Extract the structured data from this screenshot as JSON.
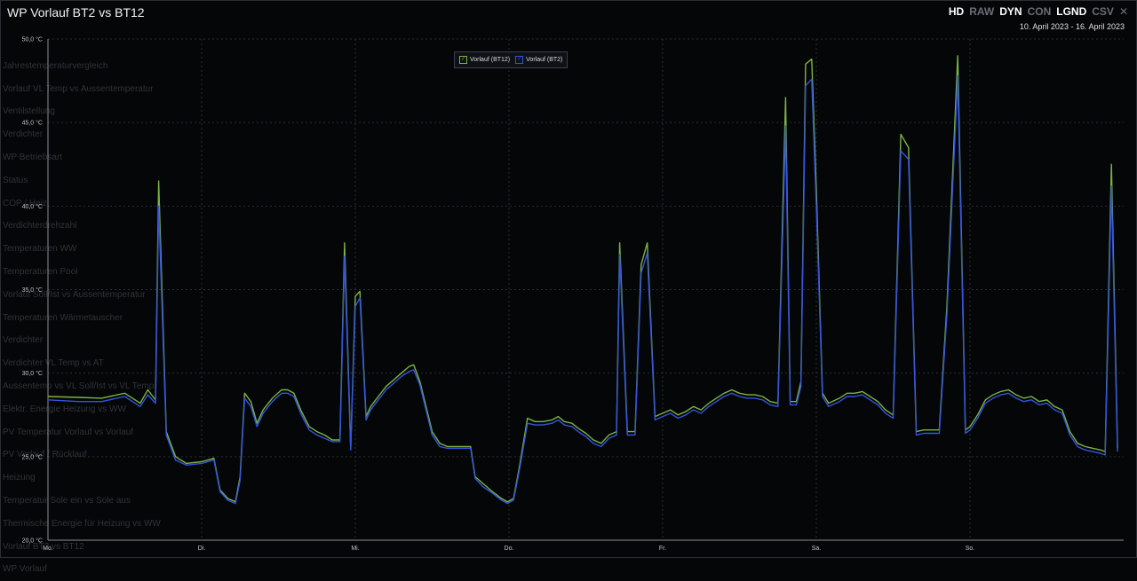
{
  "title": "WP Vorlauf BT2 vs BT12",
  "toolbar": [
    {
      "label": "HD",
      "active": true
    },
    {
      "label": "RAW",
      "active": false
    },
    {
      "label": "DYN",
      "active": true
    },
    {
      "label": "CON",
      "active": false
    },
    {
      "label": "LGND",
      "active": true
    },
    {
      "label": "CSV",
      "active": false
    }
  ],
  "close_symbol": "✕",
  "date_range": "10. April 2023 - 16. April 2023",
  "background_menu": [
    "",
    "Jahrestemperaturvergleich",
    "Vorlauf VL Temp vs Aussentemperatur",
    "Ventilstellung",
    "Verdichter",
    "WP Betriebsart",
    "Status",
    "COP / Heiz",
    "Verdichterdrehzahl",
    "Temperaturen WW",
    "Temperaturen Pool",
    "Vorlauf Soll/Ist vs Aussentemperatur",
    "Temperaturen Wärmetauscher",
    "Verdichter",
    "Verdichter VL Temp vs AT",
    "Aussentemp vs VL Soll/Ist vs VL Temp",
    "Elektr. Energie Heizung vs WW",
    "PV Temperatur Vorlauf vs Vorlauf",
    "PV Vorlauf / Rücklauf",
    "Heizung",
    "Temperatur Sole ein vs Sole aus",
    "Thermische Energie für Heizung vs WW",
    "Vorlauf BT2 vs BT12",
    "WP Vorlauf"
  ],
  "chart_data": {
    "type": "line",
    "title": "WP Vorlauf BT2 vs BT12",
    "y_unit": "°C",
    "ylim": [
      20,
      50
    ],
    "y_ticks": [
      "20,0 °C",
      "25,0 °C",
      "30,0 °C",
      "35,0 °C",
      "40,0 °C",
      "45,0 °C",
      "50,0 °C"
    ],
    "x_labels": [
      "Mo.",
      "Di.",
      "Mi.",
      "Do.",
      "Fr.",
      "Sa.",
      "So."
    ],
    "x_range_days": [
      0,
      7
    ],
    "grid": true,
    "legend_position": "top-center",
    "series": [
      {
        "name": "Vorlauf (BT12)",
        "color": "#7cb342",
        "points": [
          [
            0.0,
            28.6
          ],
          [
            0.2,
            28.55
          ],
          [
            0.35,
            28.5
          ],
          [
            0.5,
            28.8
          ],
          [
            0.6,
            28.2
          ],
          [
            0.65,
            29.0
          ],
          [
            0.7,
            28.4
          ],
          [
            0.72,
            41.5
          ],
          [
            0.77,
            26.5
          ],
          [
            0.83,
            25.0
          ],
          [
            0.9,
            24.6
          ],
          [
            1.0,
            24.7
          ],
          [
            1.08,
            24.9
          ],
          [
            1.12,
            23.0
          ],
          [
            1.17,
            22.5
          ],
          [
            1.22,
            22.3
          ],
          [
            1.25,
            23.8
          ],
          [
            1.28,
            28.8
          ],
          [
            1.32,
            28.3
          ],
          [
            1.36,
            27.0
          ],
          [
            1.4,
            27.8
          ],
          [
            1.46,
            28.5
          ],
          [
            1.52,
            29.0
          ],
          [
            1.56,
            29.0
          ],
          [
            1.6,
            28.8
          ],
          [
            1.65,
            27.7
          ],
          [
            1.7,
            26.8
          ],
          [
            1.75,
            26.5
          ],
          [
            1.8,
            26.3
          ],
          [
            1.85,
            26.0
          ],
          [
            1.9,
            26.0
          ],
          [
            1.93,
            37.8
          ],
          [
            1.97,
            25.5
          ],
          [
            2.0,
            34.6
          ],
          [
            2.03,
            34.9
          ],
          [
            2.07,
            27.4
          ],
          [
            2.1,
            28.0
          ],
          [
            2.15,
            28.6
          ],
          [
            2.2,
            29.2
          ],
          [
            2.25,
            29.6
          ],
          [
            2.3,
            30.0
          ],
          [
            2.35,
            30.4
          ],
          [
            2.38,
            30.5
          ],
          [
            2.42,
            29.5
          ],
          [
            2.46,
            28.0
          ],
          [
            2.5,
            26.5
          ],
          [
            2.55,
            25.8
          ],
          [
            2.6,
            25.6
          ],
          [
            2.65,
            25.6
          ],
          [
            2.7,
            25.6
          ],
          [
            2.75,
            25.6
          ],
          [
            2.78,
            23.8
          ],
          [
            2.83,
            23.4
          ],
          [
            2.88,
            23.0
          ],
          [
            2.95,
            22.5
          ],
          [
            2.99,
            22.3
          ],
          [
            3.03,
            22.5
          ],
          [
            3.07,
            24.5
          ],
          [
            3.12,
            27.3
          ],
          [
            3.17,
            27.1
          ],
          [
            3.22,
            27.1
          ],
          [
            3.28,
            27.2
          ],
          [
            3.32,
            27.4
          ],
          [
            3.36,
            27.1
          ],
          [
            3.41,
            27.0
          ],
          [
            3.45,
            26.7
          ],
          [
            3.5,
            26.4
          ],
          [
            3.55,
            26.0
          ],
          [
            3.6,
            25.8
          ],
          [
            3.65,
            26.3
          ],
          [
            3.7,
            26.5
          ],
          [
            3.72,
            37.8
          ],
          [
            3.77,
            26.5
          ],
          [
            3.82,
            26.5
          ],
          [
            3.86,
            36.5
          ],
          [
            3.9,
            37.8
          ],
          [
            3.95,
            27.4
          ],
          [
            4.0,
            27.6
          ],
          [
            4.05,
            27.8
          ],
          [
            4.1,
            27.5
          ],
          [
            4.15,
            27.7
          ],
          [
            4.2,
            28.0
          ],
          [
            4.25,
            27.8
          ],
          [
            4.3,
            28.2
          ],
          [
            4.35,
            28.5
          ],
          [
            4.4,
            28.8
          ],
          [
            4.45,
            29.0
          ],
          [
            4.5,
            28.8
          ],
          [
            4.55,
            28.7
          ],
          [
            4.6,
            28.7
          ],
          [
            4.65,
            28.6
          ],
          [
            4.7,
            28.3
          ],
          [
            4.75,
            28.2
          ],
          [
            4.8,
            46.5
          ],
          [
            4.83,
            28.3
          ],
          [
            4.87,
            28.3
          ],
          [
            4.9,
            29.5
          ],
          [
            4.93,
            48.5
          ],
          [
            4.97,
            48.8
          ],
          [
            5.0,
            41.0
          ],
          [
            5.04,
            28.8
          ],
          [
            5.08,
            28.2
          ],
          [
            5.15,
            28.5
          ],
          [
            5.2,
            28.8
          ],
          [
            5.25,
            28.8
          ],
          [
            5.3,
            28.9
          ],
          [
            5.35,
            28.6
          ],
          [
            5.4,
            28.3
          ],
          [
            5.45,
            27.8
          ],
          [
            5.5,
            27.5
          ],
          [
            5.55,
            44.3
          ],
          [
            5.6,
            43.5
          ],
          [
            5.65,
            26.5
          ],
          [
            5.7,
            26.6
          ],
          [
            5.75,
            26.6
          ],
          [
            5.8,
            26.6
          ],
          [
            5.85,
            34.0
          ],
          [
            5.92,
            49.0
          ],
          [
            5.97,
            26.6
          ],
          [
            6.0,
            26.8
          ],
          [
            6.05,
            27.5
          ],
          [
            6.1,
            28.4
          ],
          [
            6.15,
            28.7
          ],
          [
            6.2,
            28.9
          ],
          [
            6.25,
            29.0
          ],
          [
            6.3,
            28.7
          ],
          [
            6.35,
            28.5
          ],
          [
            6.4,
            28.6
          ],
          [
            6.45,
            28.3
          ],
          [
            6.5,
            28.4
          ],
          [
            6.55,
            28.0
          ],
          [
            6.6,
            27.8
          ],
          [
            6.65,
            26.5
          ],
          [
            6.7,
            25.8
          ],
          [
            6.75,
            25.6
          ],
          [
            6.8,
            25.5
          ],
          [
            6.85,
            25.4
          ],
          [
            6.88,
            25.3
          ],
          [
            6.92,
            42.5
          ],
          [
            6.96,
            25.5
          ]
        ]
      },
      {
        "name": "Vorlauf (BT2)",
        "color": "#3355dd",
        "points": [
          [
            0.0,
            28.4
          ],
          [
            0.2,
            28.3
          ],
          [
            0.35,
            28.3
          ],
          [
            0.5,
            28.6
          ],
          [
            0.6,
            28.0
          ],
          [
            0.65,
            28.7
          ],
          [
            0.7,
            28.2
          ],
          [
            0.72,
            40.0
          ],
          [
            0.77,
            26.3
          ],
          [
            0.83,
            24.8
          ],
          [
            0.9,
            24.5
          ],
          [
            1.0,
            24.6
          ],
          [
            1.08,
            24.8
          ],
          [
            1.12,
            22.9
          ],
          [
            1.17,
            22.4
          ],
          [
            1.22,
            22.2
          ],
          [
            1.25,
            23.6
          ],
          [
            1.28,
            28.5
          ],
          [
            1.32,
            28.0
          ],
          [
            1.36,
            26.8
          ],
          [
            1.4,
            27.6
          ],
          [
            1.46,
            28.3
          ],
          [
            1.52,
            28.8
          ],
          [
            1.56,
            28.8
          ],
          [
            1.6,
            28.6
          ],
          [
            1.65,
            27.5
          ],
          [
            1.7,
            26.6
          ],
          [
            1.75,
            26.3
          ],
          [
            1.8,
            26.1
          ],
          [
            1.85,
            25.9
          ],
          [
            1.9,
            25.9
          ],
          [
            1.93,
            37.0
          ],
          [
            1.97,
            25.4
          ],
          [
            2.0,
            34.0
          ],
          [
            2.03,
            34.5
          ],
          [
            2.07,
            27.2
          ],
          [
            2.1,
            27.8
          ],
          [
            2.15,
            28.4
          ],
          [
            2.2,
            29.0
          ],
          [
            2.25,
            29.4
          ],
          [
            2.3,
            29.8
          ],
          [
            2.35,
            30.1
          ],
          [
            2.38,
            30.2
          ],
          [
            2.42,
            29.3
          ],
          [
            2.46,
            27.8
          ],
          [
            2.5,
            26.3
          ],
          [
            2.55,
            25.6
          ],
          [
            2.6,
            25.5
          ],
          [
            2.65,
            25.5
          ],
          [
            2.7,
            25.5
          ],
          [
            2.75,
            25.5
          ],
          [
            2.78,
            23.7
          ],
          [
            2.83,
            23.2
          ],
          [
            2.88,
            22.9
          ],
          [
            2.95,
            22.4
          ],
          [
            2.99,
            22.2
          ],
          [
            3.03,
            22.4
          ],
          [
            3.07,
            24.3
          ],
          [
            3.12,
            27.0
          ],
          [
            3.17,
            26.9
          ],
          [
            3.22,
            26.9
          ],
          [
            3.28,
            27.0
          ],
          [
            3.32,
            27.2
          ],
          [
            3.36,
            26.9
          ],
          [
            3.41,
            26.8
          ],
          [
            3.45,
            26.5
          ],
          [
            3.5,
            26.2
          ],
          [
            3.55,
            25.8
          ],
          [
            3.6,
            25.6
          ],
          [
            3.65,
            26.1
          ],
          [
            3.7,
            26.3
          ],
          [
            3.72,
            37.1
          ],
          [
            3.77,
            26.3
          ],
          [
            3.82,
            26.3
          ],
          [
            3.86,
            36.0
          ],
          [
            3.9,
            37.2
          ],
          [
            3.95,
            27.2
          ],
          [
            4.0,
            27.4
          ],
          [
            4.05,
            27.6
          ],
          [
            4.1,
            27.3
          ],
          [
            4.15,
            27.5
          ],
          [
            4.2,
            27.8
          ],
          [
            4.25,
            27.6
          ],
          [
            4.3,
            28.0
          ],
          [
            4.35,
            28.3
          ],
          [
            4.4,
            28.6
          ],
          [
            4.45,
            28.8
          ],
          [
            4.5,
            28.6
          ],
          [
            4.55,
            28.5
          ],
          [
            4.6,
            28.5
          ],
          [
            4.65,
            28.4
          ],
          [
            4.7,
            28.1
          ],
          [
            4.75,
            28.0
          ],
          [
            4.8,
            44.8
          ],
          [
            4.83,
            28.1
          ],
          [
            4.87,
            28.1
          ],
          [
            4.9,
            29.2
          ],
          [
            4.93,
            47.2
          ],
          [
            4.97,
            47.6
          ],
          [
            5.0,
            40.0
          ],
          [
            5.04,
            28.6
          ],
          [
            5.08,
            28.0
          ],
          [
            5.15,
            28.3
          ],
          [
            5.2,
            28.6
          ],
          [
            5.25,
            28.6
          ],
          [
            5.3,
            28.7
          ],
          [
            5.35,
            28.4
          ],
          [
            5.4,
            28.1
          ],
          [
            5.45,
            27.6
          ],
          [
            5.5,
            27.3
          ],
          [
            5.55,
            43.3
          ],
          [
            5.6,
            42.8
          ],
          [
            5.65,
            26.3
          ],
          [
            5.7,
            26.4
          ],
          [
            5.75,
            26.4
          ],
          [
            5.8,
            26.4
          ],
          [
            5.85,
            33.5
          ],
          [
            5.92,
            47.8
          ],
          [
            5.97,
            26.4
          ],
          [
            6.0,
            26.6
          ],
          [
            6.05,
            27.3
          ],
          [
            6.1,
            28.2
          ],
          [
            6.15,
            28.5
          ],
          [
            6.2,
            28.7
          ],
          [
            6.25,
            28.8
          ],
          [
            6.3,
            28.5
          ],
          [
            6.35,
            28.3
          ],
          [
            6.4,
            28.4
          ],
          [
            6.45,
            28.1
          ],
          [
            6.5,
            28.2
          ],
          [
            6.55,
            27.8
          ],
          [
            6.6,
            27.6
          ],
          [
            6.65,
            26.3
          ],
          [
            6.7,
            25.6
          ],
          [
            6.75,
            25.4
          ],
          [
            6.8,
            25.3
          ],
          [
            6.85,
            25.2
          ],
          [
            6.88,
            25.1
          ],
          [
            6.92,
            41.2
          ],
          [
            6.96,
            25.3
          ]
        ]
      }
    ]
  }
}
